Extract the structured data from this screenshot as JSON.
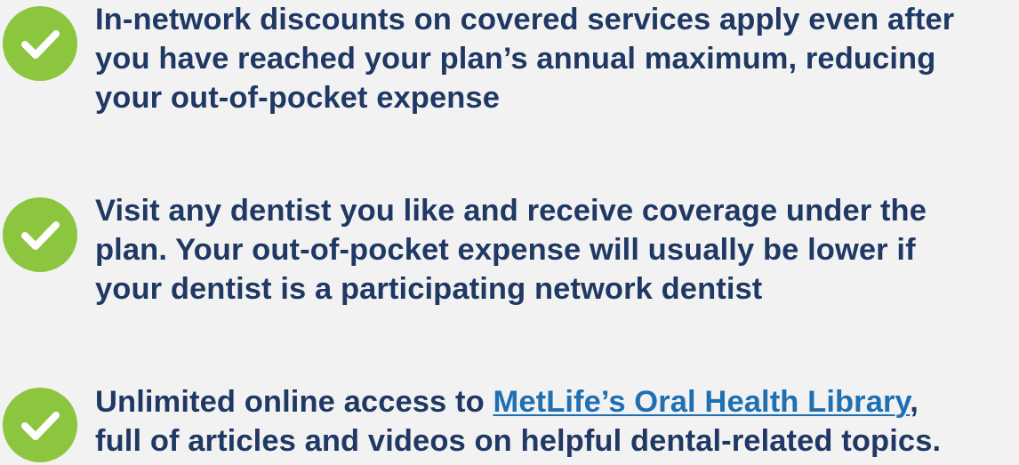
{
  "colors": {
    "background": "#f2f2f2",
    "text": "#1f3864",
    "check_badge": "#8cc63f",
    "link": "#1f6fb3"
  },
  "benefits": [
    {
      "icon": "check-circle-icon",
      "lines": [
        "In-network discounts on covered services apply even after",
        "you have reached your plan’s annual maximum, reducing",
        "your out-of-pocket expense"
      ]
    },
    {
      "icon": "check-circle-icon",
      "lines": [
        "Visit any dentist you like and receive coverage under the",
        "plan. Your out-of-pocket expense will usually be lower if",
        "your dentist is a participating network dentist"
      ]
    },
    {
      "icon": "check-circle-icon",
      "line1_prefix": "Unlimited online access to ",
      "link_text": "MetLife’s Oral Health Library",
      "line1_suffix": ",",
      "line2": "full of articles and videos on helpful dental-related topics."
    }
  ]
}
